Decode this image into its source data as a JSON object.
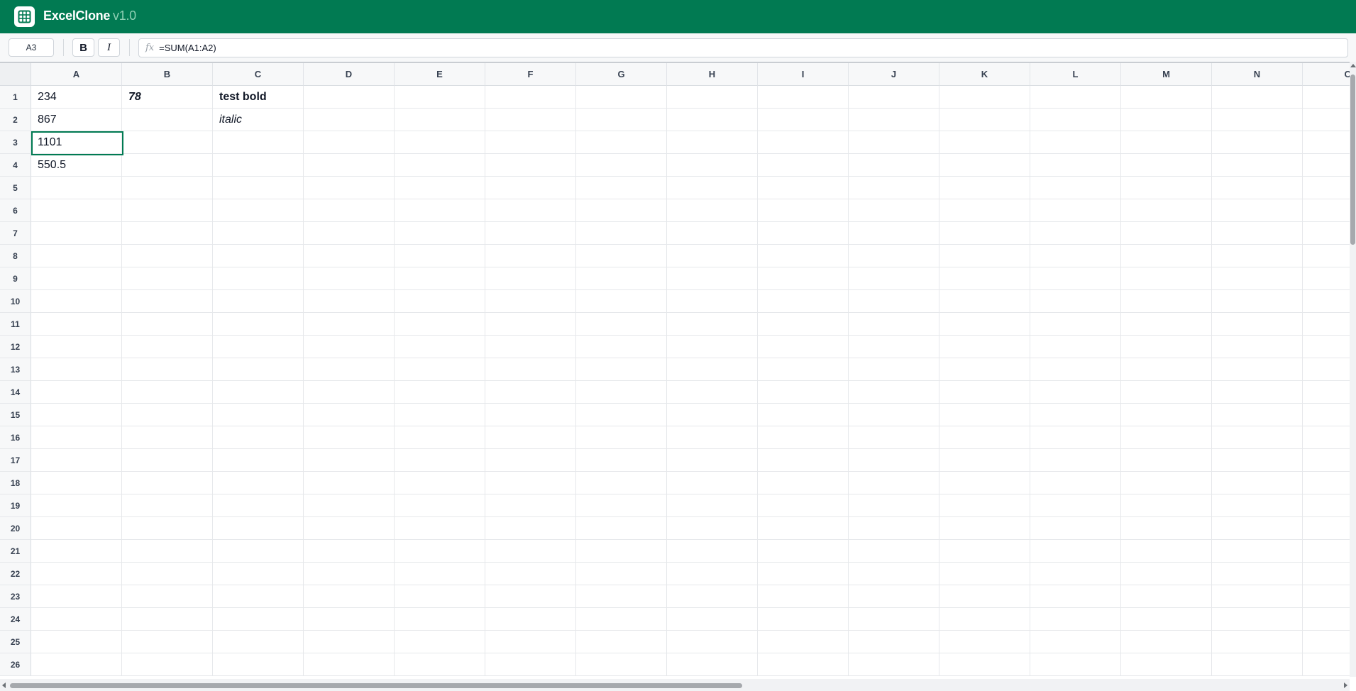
{
  "app": {
    "name": "ExcelClone",
    "version": "v1.0",
    "icon": "grid-icon",
    "brand_color": "#017a52"
  },
  "toolbar": {
    "name_box": "A3",
    "bold_label": "B",
    "italic_label": "I",
    "fx_label": "fx",
    "formula": "=SUM(A1:A2)"
  },
  "sheet": {
    "columns": [
      "A",
      "B",
      "C",
      "D",
      "E",
      "F",
      "G",
      "H",
      "I",
      "J",
      "K",
      "L",
      "M",
      "N",
      "O"
    ],
    "rows": [
      "1",
      "2",
      "3",
      "4",
      "5",
      "6",
      "7",
      "8",
      "9",
      "10",
      "11",
      "12",
      "13",
      "14",
      "15",
      "16",
      "17",
      "18",
      "19",
      "20",
      "21",
      "22",
      "23",
      "24",
      "25",
      "26"
    ],
    "selected_cell": "A3",
    "cells": [
      {
        "ref": "A1",
        "value": "234",
        "style": "normal"
      },
      {
        "ref": "B1",
        "value": "78",
        "style": "bold-italic"
      },
      {
        "ref": "C1",
        "value": "test bold",
        "style": "bold"
      },
      {
        "ref": "A2",
        "value": "867",
        "style": "normal"
      },
      {
        "ref": "C2",
        "value": "italic",
        "style": "italic"
      },
      {
        "ref": "A3",
        "value": "1101",
        "style": "normal"
      },
      {
        "ref": "A4",
        "value": "550.5",
        "style": "normal"
      }
    ]
  }
}
